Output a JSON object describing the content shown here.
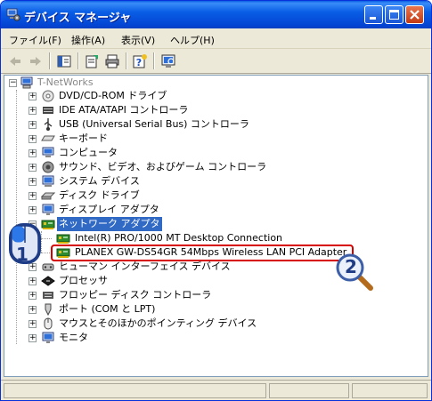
{
  "window": {
    "title": "デバイス マネージャ"
  },
  "menu": [
    "ファイル(F)",
    "操作(A)",
    "表示(V)",
    "ヘルプ(H)"
  ],
  "tree": {
    "root": "T-NetWorks",
    "categories": [
      {
        "label": "DVD/CD-ROM ドライブ",
        "icon": "cdrom-icon"
      },
      {
        "label": "IDE ATA/ATAPI コントローラ",
        "icon": "ide-controller-icon"
      },
      {
        "label": "USB (Universal Serial Bus) コントローラ",
        "icon": "usb-icon"
      },
      {
        "label": "キーボード",
        "icon": "keyboard-icon"
      },
      {
        "label": "コンピュータ",
        "icon": "computer-icon"
      },
      {
        "label": "サウンド、ビデオ、およびゲーム コントローラ",
        "icon": "sound-icon"
      },
      {
        "label": "システム デバイス",
        "icon": "system-device-icon"
      },
      {
        "label": "ディスク ドライブ",
        "icon": "disk-drive-icon"
      },
      {
        "label": "ディスプレイ アダプタ",
        "icon": "display-adapter-icon"
      },
      {
        "label": "ネットワーク アダプタ",
        "icon": "network-adapter-icon",
        "expanded": true,
        "selected": true,
        "children": [
          {
            "label": "Intel(R) PRO/1000 MT Desktop Connection",
            "icon": "network-card-icon"
          },
          {
            "label": "PLANEX GW-DS54GR 54Mbps Wireless LAN PCI Adapter",
            "icon": "network-card-icon",
            "highlighted": true
          }
        ]
      },
      {
        "label": "ヒューマン インターフェイス デバイス",
        "icon": "hid-icon"
      },
      {
        "label": "プロセッサ",
        "icon": "processor-icon"
      },
      {
        "label": "フロッピー ディスク コントローラ",
        "icon": "floppy-controller-icon"
      },
      {
        "label": "ポート (COM と LPT)",
        "icon": "port-icon"
      },
      {
        "label": "マウスとそのほかのポインティング デバイス",
        "icon": "mouse-icon"
      },
      {
        "label": "モニタ",
        "icon": "monitor-icon"
      }
    ]
  },
  "annotations": {
    "step1": "1",
    "step2": "2"
  },
  "colors": {
    "selection": "#316ac5",
    "callout": "#d60000",
    "titlebar": "#0a5ee6"
  }
}
